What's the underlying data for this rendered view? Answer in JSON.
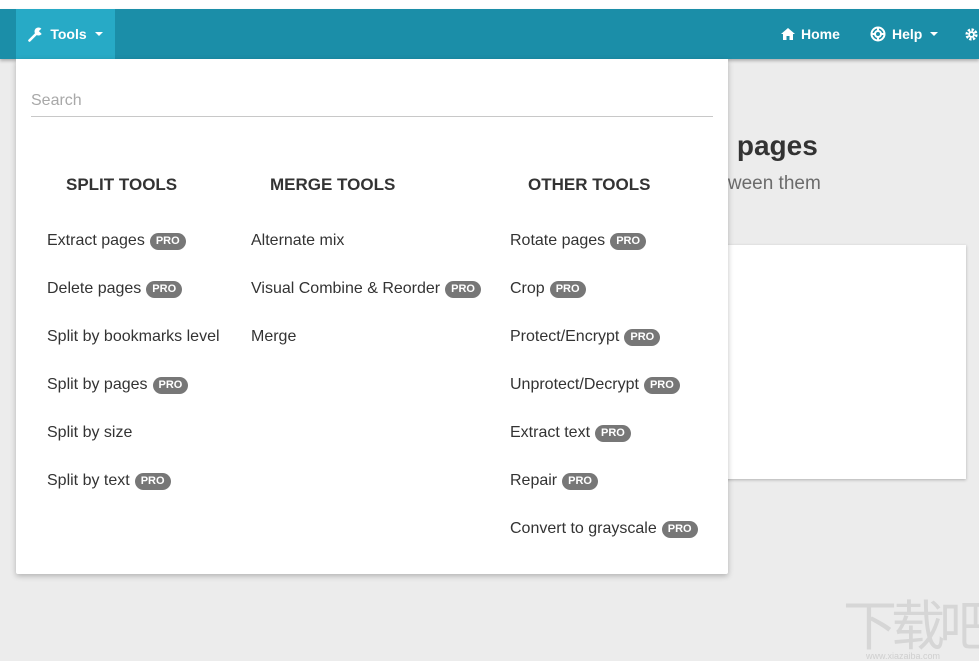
{
  "navbar": {
    "tools_label": "Tools",
    "home_label": "Home",
    "help_label": "Help"
  },
  "background": {
    "title_fragment": "n pages",
    "subtitle_fragment": "etween them"
  },
  "dropdown": {
    "search_placeholder": "Search",
    "pro_label": "PRO",
    "columns": [
      {
        "heading": "SPLIT TOOLS",
        "items": [
          {
            "label": "Extract pages",
            "pro": true
          },
          {
            "label": "Delete pages",
            "pro": true
          },
          {
            "label": "Split by bookmarks level",
            "pro": false
          },
          {
            "label": "Split by pages",
            "pro": true
          },
          {
            "label": "Split by size",
            "pro": false
          },
          {
            "label": "Split by text",
            "pro": true
          }
        ]
      },
      {
        "heading": "MERGE TOOLS",
        "items": [
          {
            "label": "Alternate mix",
            "pro": false
          },
          {
            "label": "Visual Combine & Reorder",
            "pro": true
          },
          {
            "label": "Merge",
            "pro": false
          }
        ]
      },
      {
        "heading": "OTHER TOOLS",
        "items": [
          {
            "label": "Rotate pages",
            "pro": true
          },
          {
            "label": "Crop",
            "pro": true
          },
          {
            "label": "Protect/Encrypt",
            "pro": true
          },
          {
            "label": "Unprotect/Decrypt",
            "pro": true
          },
          {
            "label": "Extract text",
            "pro": true
          },
          {
            "label": "Repair",
            "pro": true
          },
          {
            "label": "Convert to grayscale",
            "pro": true
          }
        ]
      }
    ]
  },
  "watermark": {
    "logo_text": "下载吧",
    "url": "www.xiazaiba.com"
  },
  "colors": {
    "navbar": "#1b8ea8",
    "tools_active": "#27aac6",
    "pro_badge": "#777777",
    "background": "#ececec"
  }
}
